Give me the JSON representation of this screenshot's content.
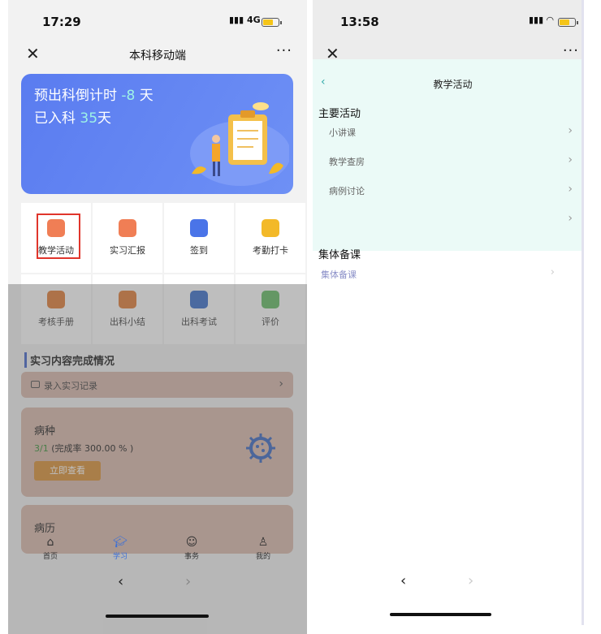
{
  "left": {
    "status": {
      "time": "17:29",
      "signal": "4G"
    },
    "nav": {
      "close": "✕",
      "title": "本科移动端",
      "more": "···"
    },
    "banner": {
      "line1_label": "预出科倒计时",
      "line1_value": "-8",
      "line1_unit": "天",
      "line2_label": "已入科",
      "line2_value": "35",
      "line2_unit": "天"
    },
    "grid": [
      {
        "label": "教学活动",
        "color": "#f07e55"
      },
      {
        "label": "实习汇报",
        "color": "#f07e55"
      },
      {
        "label": "签到",
        "color": "#4a74e8"
      },
      {
        "label": "考勤打卡",
        "color": "#f3b928"
      },
      {
        "label": "考核手册",
        "color": "#e0752a"
      },
      {
        "label": "出科小结",
        "color": "#e0752a"
      },
      {
        "label": "出科考试",
        "color": "#2f67c9"
      },
      {
        "label": "评价",
        "color": "#5cb85c"
      }
    ],
    "section_title": "实习内容完成情况",
    "record_label": "录入实习记录",
    "card1": {
      "title": "病种",
      "done": "3",
      "total": "1",
      "rate_text": "(完成率 300.00 % )",
      "button": "立即查看"
    },
    "card2": {
      "title": "病历"
    },
    "tabs": [
      {
        "label": "首页",
        "icon": "home-icon"
      },
      {
        "label": "学习",
        "icon": "graduation-cap-icon"
      },
      {
        "label": "事务",
        "icon": "chat-icon"
      },
      {
        "label": "我的",
        "icon": "user-icon"
      }
    ]
  },
  "right": {
    "status": {
      "time": "13:58"
    },
    "nav": {
      "close": "✕",
      "more": "···"
    },
    "page_title": "教学活动",
    "section1": "主要活动",
    "items": [
      "小讲课",
      "教学查房",
      "病例讨论",
      ""
    ],
    "section2": "集体备课",
    "items2": [
      "集体备课"
    ]
  }
}
